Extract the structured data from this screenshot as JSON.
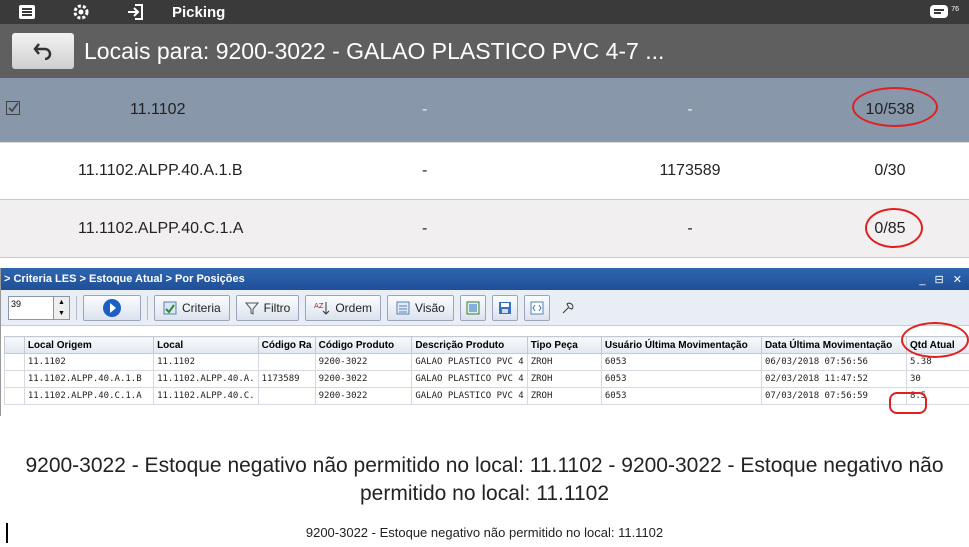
{
  "topbar": {
    "title": "Picking",
    "icons": [
      "menu-icon",
      "gear-icon",
      "login-icon",
      "notification-icon"
    ],
    "badge": "76"
  },
  "header": {
    "title": "Locais para: 9200-3022 - GALAO PLASTICO PVC 4-7 ..."
  },
  "locations": [
    {
      "local": "11.1102",
      "col2": "-",
      "col3": "-",
      "qty": "10/538",
      "selected": true
    },
    {
      "local": "11.1102.ALPP.40.A.1.B",
      "col2": "-",
      "col3": "1173589",
      "qty": "0/30",
      "selected": false
    },
    {
      "local": "11.1102.ALPP.40.C.1.A",
      "col2": "-",
      "col3": "-",
      "qty": "0/85",
      "selected": false
    }
  ],
  "les": {
    "breadcrumb": "> Criteria LES > Estoque Atual > Por Posições",
    "window_controls": "_ ⊟ ✕",
    "toolbar": {
      "page_size": "39",
      "criteria": "Criteria",
      "filtro": "Filtro",
      "ordem": "Ordem",
      "visao": "Visão"
    },
    "columns": [
      "Local Origem",
      "Local",
      "Código Ra",
      "Código Produto",
      "Descrição Produto",
      "Tipo Peça",
      "Usuário Última Movimentação",
      "Data Última Movimentação",
      "Qtd Atual"
    ],
    "rows": [
      [
        "11.1102",
        "11.1102",
        "",
        "9200-3022",
        "GALAO PLASTICO PVC 4",
        "ZROH",
        "6053",
        "06/03/2018 07:56:56",
        "5.38"
      ],
      [
        "11.1102.ALPP.40.A.1.B",
        "11.1102.ALPP.40.A.",
        "1173589",
        "9200-3022",
        "GALAO PLASTICO PVC 4",
        "ZROH",
        "6053",
        "02/03/2018 11:47:52",
        "30"
      ],
      [
        "11.1102.ALPP.40.C.1.A",
        "11.1102.ALPP.40.C.",
        "",
        "9200-3022",
        "GALAO PLASTICO PVC 4",
        "ZROH",
        "6053",
        "07/03/2018 07:56:59",
        "8.5"
      ]
    ]
  },
  "errors": {
    "big": "9200-3022 - Estoque negativo não permitido no local: 11.1102 - 9200-3022 - Estoque negativo não permitido no local: 11.1102",
    "small": "9200-3022 - Estoque negativo não permitido no local: 11.1102"
  },
  "colors": {
    "topbar": "#3a3a3a",
    "header": "#5f5f5f",
    "selected_row": "#8897aa",
    "les_title": "#2a5da6",
    "annotation": "#e02020"
  }
}
